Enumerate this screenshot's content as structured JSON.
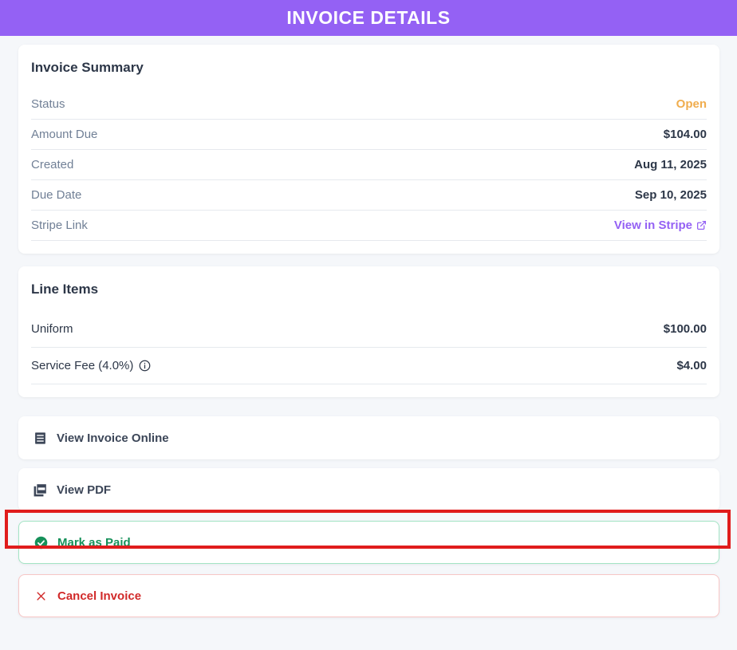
{
  "header": {
    "title": "INVOICE DETAILS"
  },
  "summary": {
    "title": "Invoice Summary",
    "rows": [
      {
        "label": "Status",
        "value": "Open"
      },
      {
        "label": "Amount Due",
        "value": "$104.00"
      },
      {
        "label": "Created",
        "value": "Aug 11, 2025"
      },
      {
        "label": "Due Date",
        "value": "Sep 10, 2025"
      },
      {
        "label": "Stripe Link",
        "value": "View in Stripe"
      }
    ]
  },
  "line_items": {
    "title": "Line Items",
    "items": [
      {
        "label": "Uniform",
        "value": "$100.00"
      },
      {
        "label": "Service Fee (4.0%)",
        "value": "$4.00"
      }
    ]
  },
  "actions": {
    "view_online": "View Invoice Online",
    "view_pdf": "View PDF",
    "mark_paid": "Mark as Paid",
    "cancel": "Cancel Invoice"
  },
  "colors": {
    "brand": "#9461f4",
    "status_open": "#f0ad4e",
    "success": "#16915a",
    "danger": "#d12a2a",
    "highlight": "#e01c1c"
  }
}
